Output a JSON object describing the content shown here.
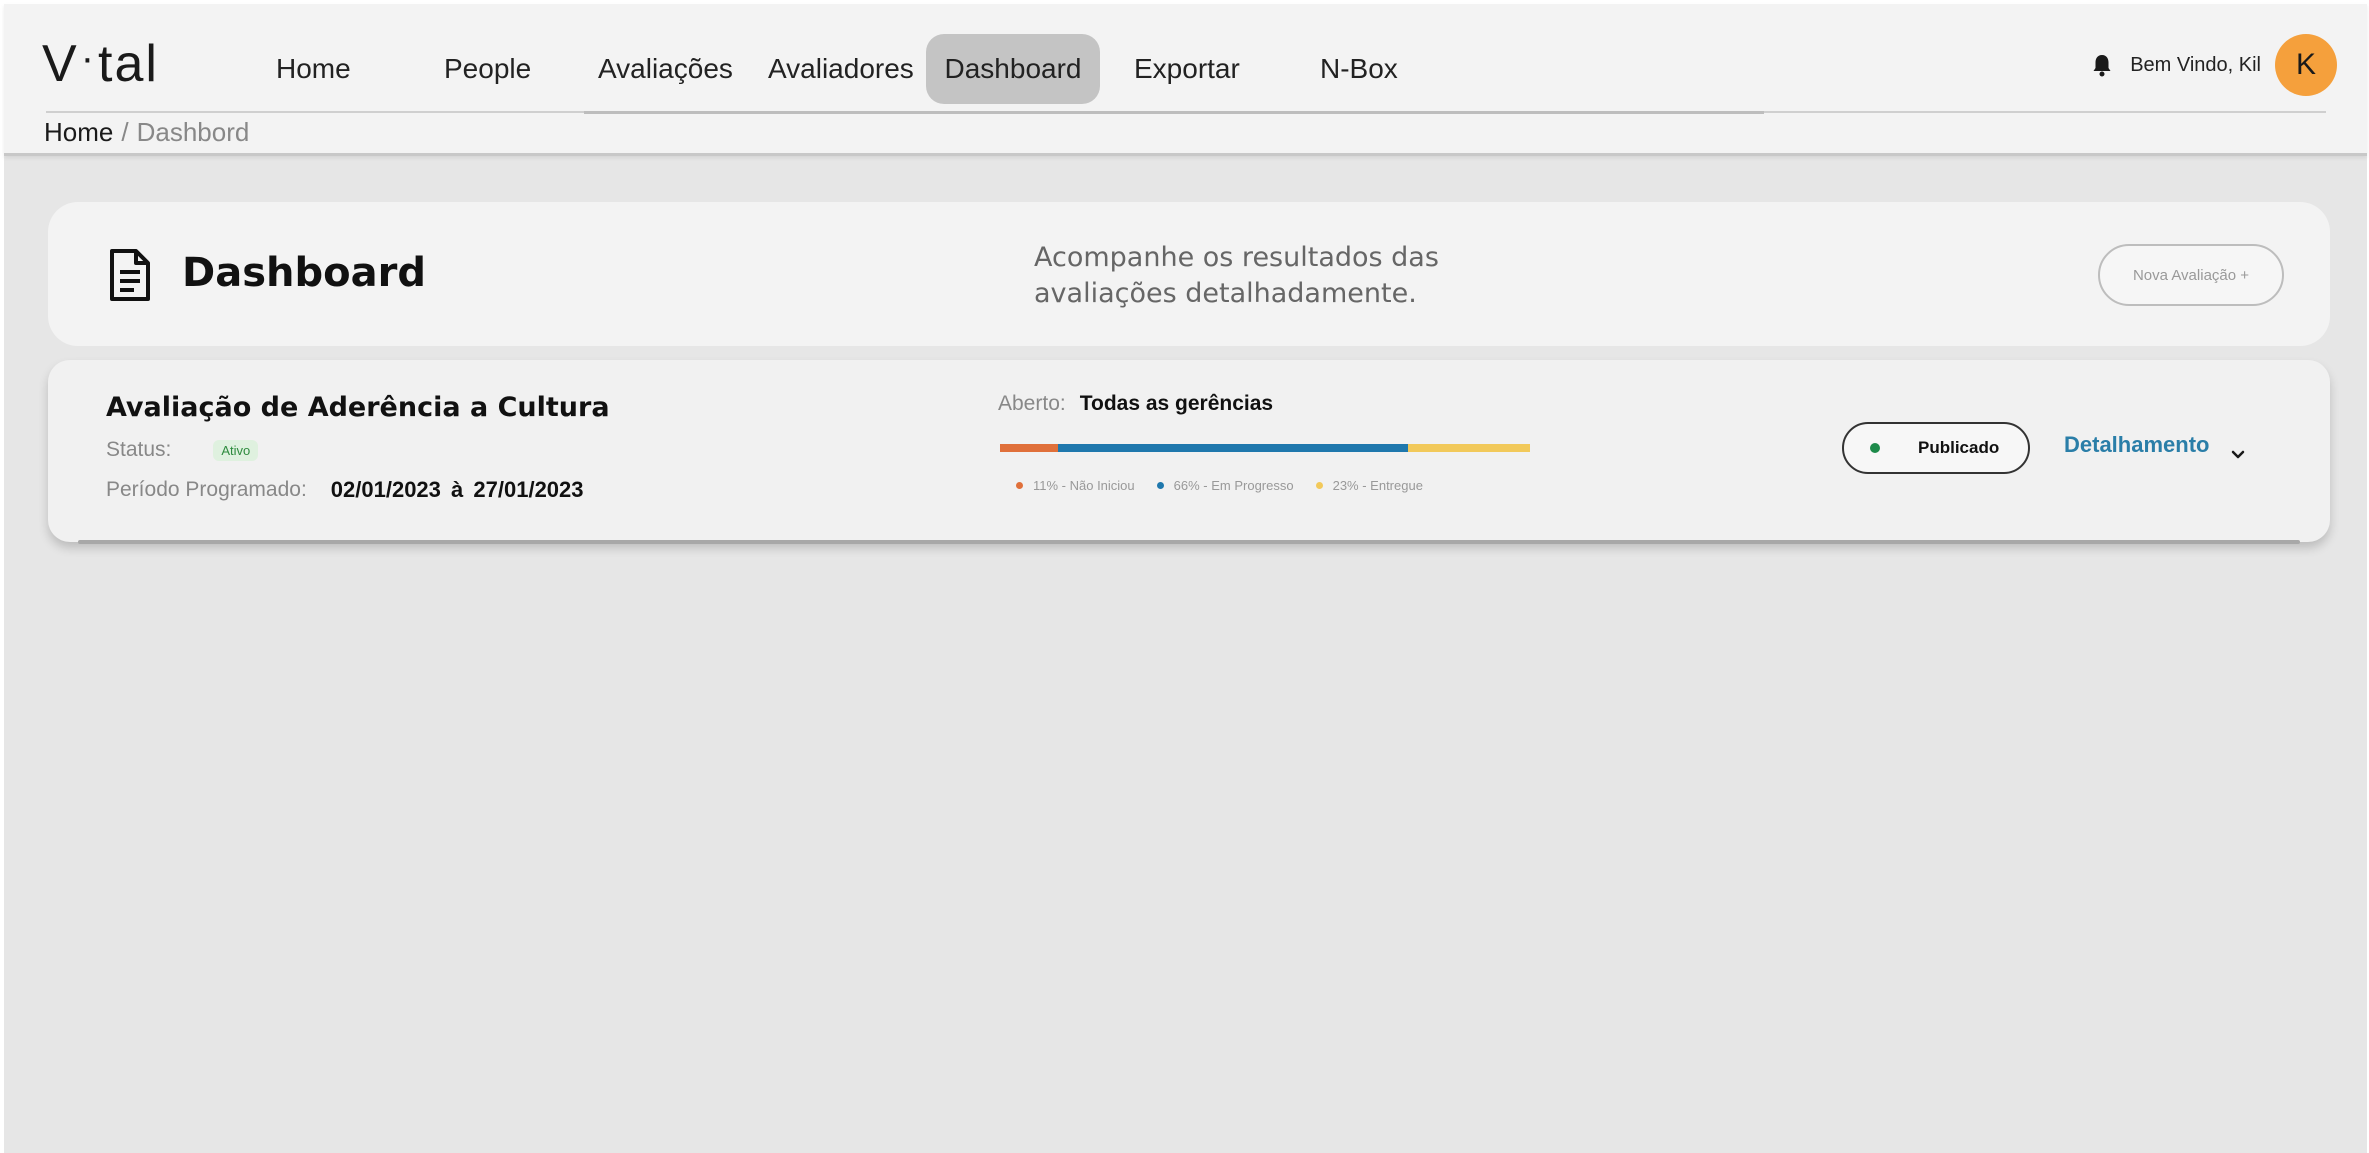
{
  "header": {
    "logo_left": "V",
    "logo_dot": "·",
    "logo_right": "tal",
    "welcome": "Bem Vindo, Kil",
    "avatar_initial": "K",
    "icons": {
      "notification": "bell-icon"
    }
  },
  "nav": {
    "items": [
      {
        "label": "Home"
      },
      {
        "label": "People"
      },
      {
        "label": "Avaliações"
      },
      {
        "label": "Avaliadores"
      },
      {
        "label": "Dashboard"
      },
      {
        "label": "Exportar"
      },
      {
        "label": "N-Box"
      }
    ],
    "active": "Dashboard"
  },
  "breadcrumb": {
    "home": "Home",
    "separator": "/",
    "current": "Dashbord"
  },
  "title_card": {
    "title": "Dashboard",
    "subtitle": "Acompanhe os resultados das avaliações detalhadamente.",
    "new_button": "Nova Avaliação +",
    "icon": "document-icon"
  },
  "evaluation": {
    "title": "Avaliação de Aderência a Cultura",
    "status_label": "Status:",
    "status_value": "Ativo",
    "period_label": "Período Programado:",
    "period_start": "02/01/2023",
    "period_sep": "à",
    "period_end": "27/01/2023",
    "open_label": "Aberto:",
    "open_value": "Todas as gerências",
    "progress": [
      {
        "label": "11% - Não Iniciou",
        "percent": 11,
        "color": "#e0703a"
      },
      {
        "label": "66% - Em Progresso",
        "percent": 66,
        "color": "#1f78ad"
      },
      {
        "label": "23% - Entregue",
        "percent": 23,
        "color": "#f2c95a"
      }
    ],
    "published_label": "Publicado",
    "published_color": "#1d8a4a",
    "detail_label": "Detalhamento"
  }
}
